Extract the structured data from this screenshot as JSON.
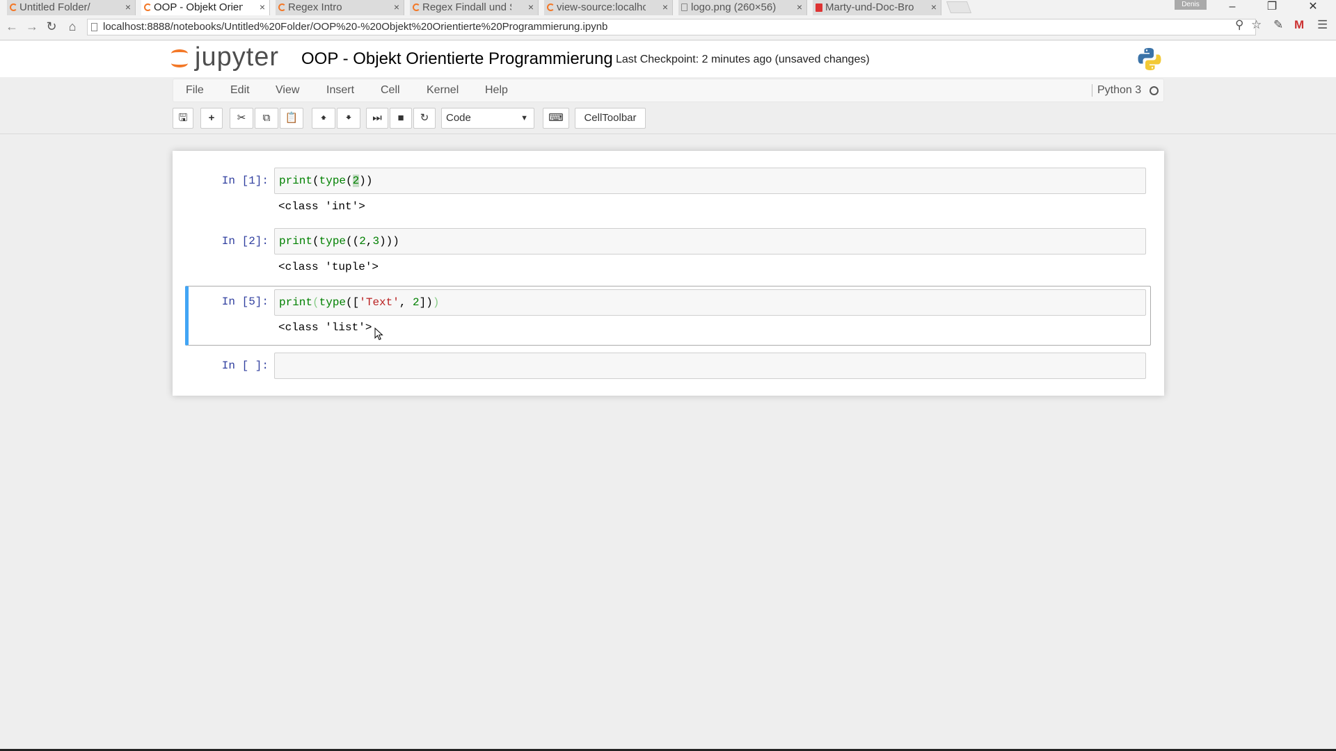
{
  "browser": {
    "tabs": [
      {
        "label": "Untitled Folder/",
        "icon": "jupyter-favicon-icon",
        "active": false
      },
      {
        "label": "OOP - Objekt Orient",
        "icon": "jupyter-favicon-icon",
        "active": true
      },
      {
        "label": "Regex Intro",
        "icon": "jupyter-favicon-icon",
        "active": false
      },
      {
        "label": "Regex Findall und Sp",
        "icon": "jupyter-favicon-icon",
        "active": false
      },
      {
        "label": "view-source:localhos",
        "icon": "jupyter-favicon-icon",
        "active": false
      },
      {
        "label": "logo.png (260×56)",
        "icon": "page-icon",
        "active": false
      },
      {
        "label": "Marty-und-Doc-Bro",
        "icon": "pdf-icon",
        "active": false
      }
    ],
    "close_glyph": "×",
    "profile": "Denis",
    "url": "localhost:8888/notebooks/Untitled%20Folder/OOP%20-%20Objekt%20Orientierte%20Programmierung.ipynb"
  },
  "jupyter": {
    "logo_text": "jupyter",
    "notebook_title": "OOP - Objekt Orientierte Programmierung",
    "checkpoint": "Last Checkpoint: 2 minutes ago (unsaved changes)",
    "menu": [
      "File",
      "Edit",
      "View",
      "Insert",
      "Cell",
      "Kernel",
      "Help"
    ],
    "kernel_name": "Python 3",
    "cell_type": "Code",
    "celltoolbar_label": "CellToolbar"
  },
  "cells": [
    {
      "prompt": "In [1]:",
      "code": "print(type(2))",
      "output": "<class 'int'>"
    },
    {
      "prompt": "In [2]:",
      "code": "print(type((2,3)))",
      "output": "<class 'tuple'>"
    },
    {
      "prompt": "In [5]:",
      "code": "print(type(['Text', 2]))",
      "output": "<class 'list'>"
    },
    {
      "prompt": "In [ ]:",
      "code": "",
      "output": ""
    }
  ],
  "colors": {
    "accent_orange": "#f37726",
    "selected_cell_border": "#42a5f5",
    "prompt_blue": "#303f9f"
  }
}
